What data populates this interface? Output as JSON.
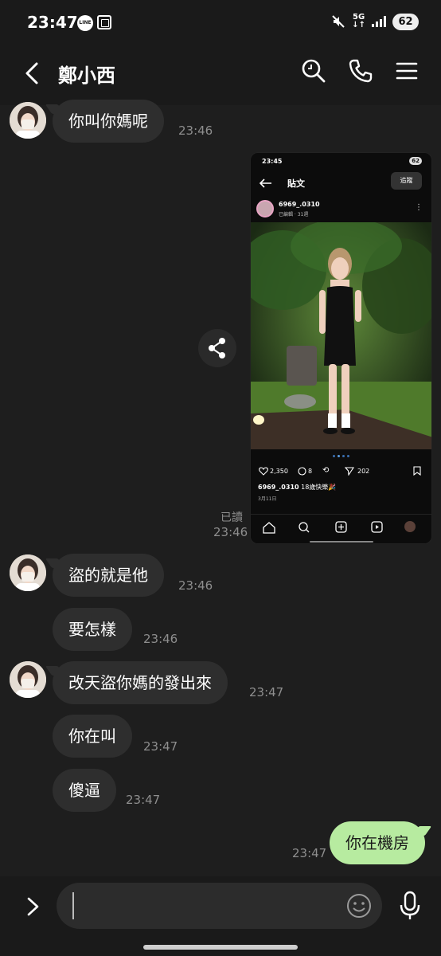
{
  "status_bar": {
    "time": "23:47",
    "line_badge": "LINE",
    "network": "5G",
    "battery": "62"
  },
  "header": {
    "title": "鄭小西"
  },
  "messages": [
    {
      "sender": "contact",
      "text": "你叫你媽呢",
      "time": "23:46"
    },
    {
      "sender": "me",
      "type": "image",
      "read_label": "已讀",
      "time": "23:46"
    },
    {
      "sender": "contact",
      "text": "盜的就是他",
      "time": "23:46"
    },
    {
      "sender": "contact",
      "text": "要怎樣",
      "time": "23:46"
    },
    {
      "sender": "contact",
      "text": "改天盜你媽的發出來",
      "time": "23:47"
    },
    {
      "sender": "contact",
      "text": "你在叫",
      "time": "23:47"
    },
    {
      "sender": "contact",
      "text": "傻逼",
      "time": "23:47"
    },
    {
      "sender": "me",
      "text": "你在機房",
      "time": "23:47"
    }
  ],
  "shared_screenshot": {
    "status_time": "23:45",
    "battery": "62",
    "page_title": "貼文",
    "follow_label": "追蹤",
    "username": "6969_.0310",
    "meta": "已編輯 · 31週",
    "likes": "2,350",
    "comments": "8",
    "shares": "202",
    "caption_user": "6969_.0310",
    "caption_text": "18歲快樂🎉",
    "date": "3月11日"
  },
  "input": {
    "placeholder": "",
    "value": ""
  },
  "colors": {
    "background": "#1e1e1e",
    "incoming_bubble": "#2e2e2e",
    "outgoing_bubble": "#b7eba0",
    "timestamp": "#8e8e8e"
  },
  "icons": [
    "back-icon",
    "search-icon",
    "phone-icon",
    "menu-icon",
    "share-icon",
    "expand-icon",
    "emoji-icon",
    "mic-icon"
  ]
}
